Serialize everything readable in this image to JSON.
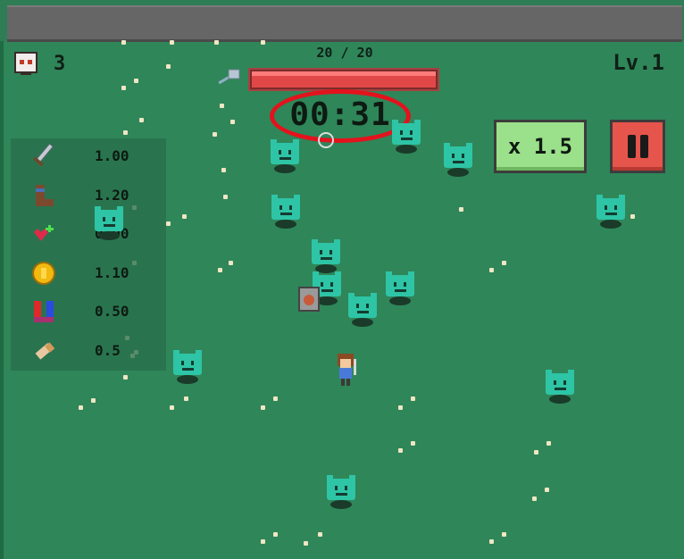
{
  "hud": {
    "kill_count": "3",
    "hp_text": "20 / 20",
    "hp_fraction": 1.0,
    "level": "Lv.1",
    "timer": "00:31",
    "speed_label": "x 1.5"
  },
  "stats": [
    {
      "icon": "sword-icon",
      "value": "1.00"
    },
    {
      "icon": "boot-icon",
      "value": "1.20"
    },
    {
      "icon": "heart-regen-icon",
      "value": "0.00"
    },
    {
      "icon": "coin-icon",
      "value": "1.10"
    },
    {
      "icon": "magnet-icon",
      "value": "0.50"
    },
    {
      "icon": "bullet-icon",
      "value": "0.5"
    }
  ],
  "colors": {
    "grass": "#2f8659",
    "enemy": "#2ec4a6",
    "hp_bar": "#e04848",
    "speed_button": "#9be08a",
    "pause_button": "#e6554b",
    "timer_highlight": "#e3131d"
  }
}
